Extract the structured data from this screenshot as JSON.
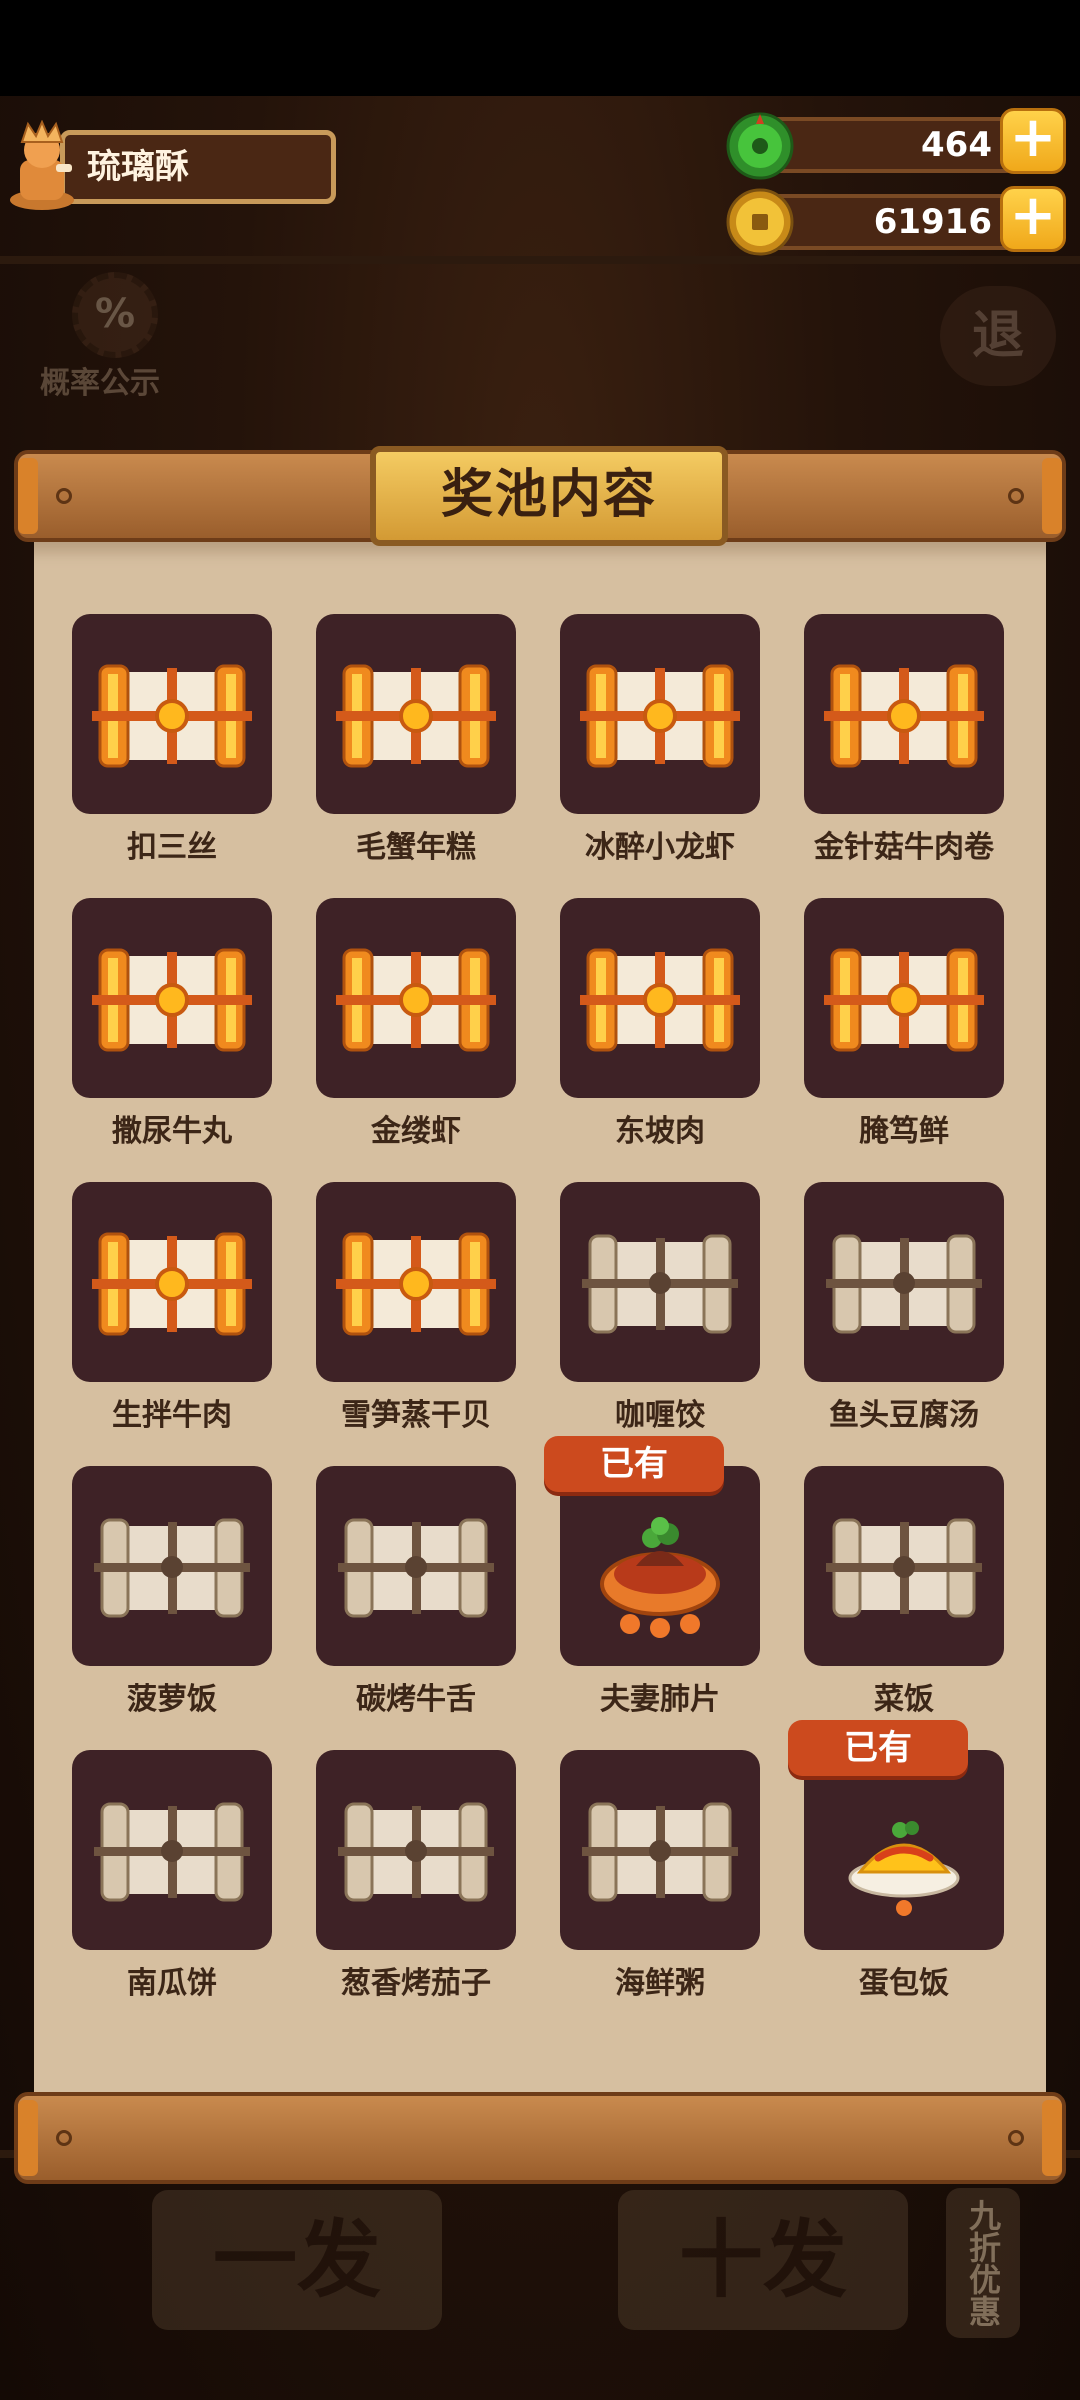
{
  "player": {
    "name": "琉璃酥"
  },
  "currency": {
    "jade": {
      "value": "464",
      "icon": "jade-icon"
    },
    "coins": {
      "value": "61916",
      "icon": "coin-icon"
    }
  },
  "buttons": {
    "probability": {
      "icon_text": "%",
      "label": "概率公示"
    },
    "exit": {
      "label": "退"
    },
    "single_draw": "一发",
    "ten_draw": "十发",
    "discount": "九折优惠"
  },
  "panel": {
    "title": "奖池内容"
  },
  "owned_label": "已有",
  "items": [
    {
      "name": "扣三丝",
      "kind": "golden-scroll",
      "owned": false
    },
    {
      "name": "毛蟹年糕",
      "kind": "golden-scroll",
      "owned": false
    },
    {
      "name": "冰醉小龙虾",
      "kind": "golden-scroll",
      "owned": false
    },
    {
      "name": "金针菇牛肉卷",
      "kind": "golden-scroll",
      "owned": false
    },
    {
      "name": "撒尿牛丸",
      "kind": "golden-scroll",
      "owned": false
    },
    {
      "name": "金缕虾",
      "kind": "golden-scroll",
      "owned": false
    },
    {
      "name": "东坡肉",
      "kind": "golden-scroll",
      "owned": false
    },
    {
      "name": "腌笃鲜",
      "kind": "golden-scroll",
      "owned": false
    },
    {
      "name": "生拌牛肉",
      "kind": "golden-scroll",
      "owned": false
    },
    {
      "name": "雪笋蒸干贝",
      "kind": "golden-scroll",
      "owned": false
    },
    {
      "name": "咖喱饺",
      "kind": "plain-scroll",
      "owned": false
    },
    {
      "name": "鱼头豆腐汤",
      "kind": "plain-scroll",
      "owned": false
    },
    {
      "name": "菠萝饭",
      "kind": "plain-scroll",
      "owned": false
    },
    {
      "name": "碳烤牛舌",
      "kind": "plain-scroll",
      "owned": false
    },
    {
      "name": "夫妻肺片",
      "kind": "dish-fuqifeipian",
      "owned": true
    },
    {
      "name": "菜饭",
      "kind": "plain-scroll",
      "owned": false
    },
    {
      "name": "南瓜饼",
      "kind": "plain-scroll",
      "owned": false
    },
    {
      "name": "葱香烤茄子",
      "kind": "plain-scroll",
      "owned": false
    },
    {
      "name": "海鲜粥",
      "kind": "plain-scroll",
      "owned": false
    },
    {
      "name": "蛋包饭",
      "kind": "dish-omurice",
      "owned": true
    }
  ]
}
